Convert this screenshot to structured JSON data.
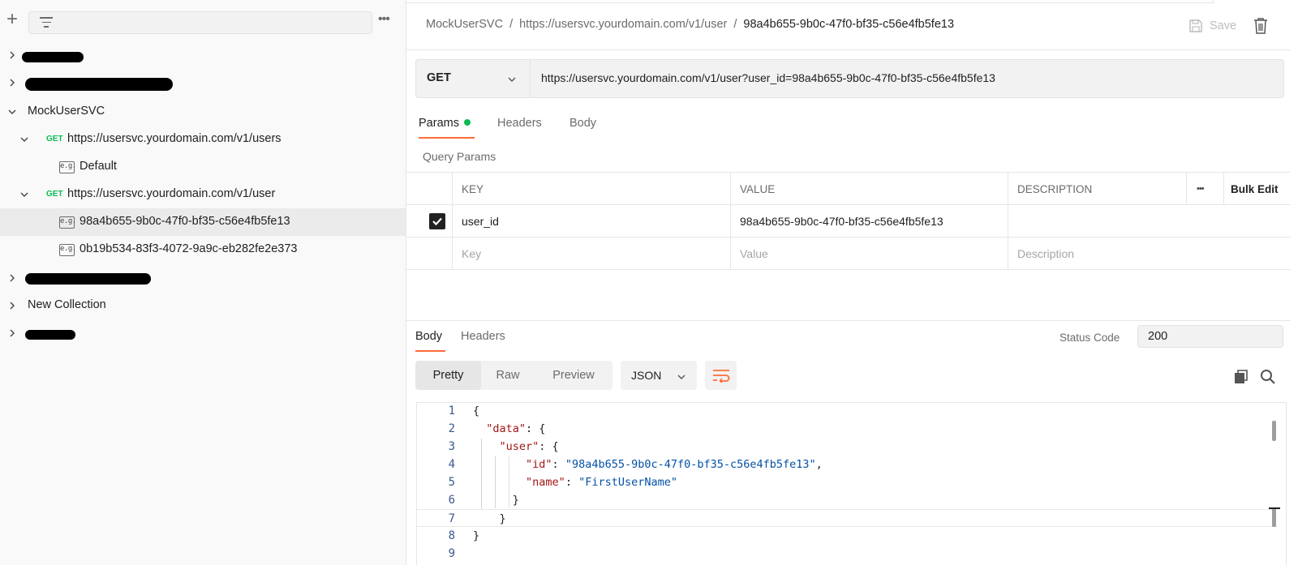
{
  "sidebar": {
    "collections": [
      {
        "label": "",
        "redacted": true,
        "expanded": false
      },
      {
        "label": "",
        "redacted": true,
        "expanded": false
      },
      {
        "label": "MockUserSVC",
        "expanded": true
      },
      {
        "label": "",
        "redacted": true,
        "expanded": false
      },
      {
        "label": "New Collection",
        "expanded": false
      },
      {
        "label": "",
        "redacted": true,
        "expanded": false
      }
    ],
    "requests": [
      {
        "method": "GET",
        "url": "https://usersvc.yourdomain.com/v1/users",
        "examples": [
          {
            "badge": "e.g.",
            "label": "Default"
          }
        ]
      },
      {
        "method": "GET",
        "url": "https://usersvc.yourdomain.com/v1/user",
        "examples": [
          {
            "badge": "e.g.",
            "label": "98a4b655-9b0c-47f0-bf35-c56e4fb5fe13",
            "selected": true
          },
          {
            "badge": "e.g.",
            "label": "0b19b534-83f3-4072-9a9c-eb282fe2e373"
          }
        ]
      }
    ]
  },
  "breadcrumb": {
    "collection": "MockUserSVC",
    "request": "https://usersvc.yourdomain.com/v1/user",
    "current": "98a4b655-9b0c-47f0-bf35-c56e4fb5fe13",
    "separator": "/"
  },
  "toolbar": {
    "save_label": "Save"
  },
  "request": {
    "method": "GET",
    "url": "https://usersvc.yourdomain.com/v1/user?user_id=98a4b655-9b0c-47f0-bf35-c56e4fb5fe13",
    "tabs": [
      {
        "label": "Params",
        "active": true,
        "indicator": "green-dot"
      },
      {
        "label": "Headers"
      },
      {
        "label": "Body"
      }
    ],
    "section_title": "Query Params",
    "params_table": {
      "columns": [
        "KEY",
        "VALUE",
        "DESCRIPTION"
      ],
      "more_label": "•••",
      "bulk_edit_label": "Bulk Edit",
      "rows": [
        {
          "checked": true,
          "key": "user_id",
          "value": "98a4b655-9b0c-47f0-bf35-c56e4fb5fe13",
          "description": ""
        }
      ],
      "placeholders": {
        "key": "Key",
        "value": "Value",
        "description": "Description"
      }
    }
  },
  "response": {
    "tabs": [
      {
        "label": "Body",
        "active": true
      },
      {
        "label": "Headers"
      }
    ],
    "status_code_label": "Status Code",
    "status_code_value": "200",
    "format_tabs": [
      {
        "label": "Pretty",
        "active": true
      },
      {
        "label": "Raw"
      },
      {
        "label": "Preview"
      }
    ],
    "language": "JSON",
    "code_lines": [
      {
        "n": "1",
        "tokens": [
          [
            "p",
            "{"
          ]
        ]
      },
      {
        "n": "2",
        "tokens": [
          [
            "p",
            "  "
          ],
          [
            "k",
            "\"data\""
          ],
          [
            "p",
            ": {"
          ]
        ]
      },
      {
        "n": "3",
        "tokens": [
          [
            "p",
            "    "
          ],
          [
            "k",
            "\"user\""
          ],
          [
            "p",
            ": {"
          ]
        ]
      },
      {
        "n": "4",
        "tokens": [
          [
            "p",
            "        "
          ],
          [
            "k",
            "\"id\""
          ],
          [
            "p",
            ": "
          ],
          [
            "s",
            "\"98a4b655-9b0c-47f0-bf35-c56e4fb5fe13\""
          ],
          [
            "p",
            ","
          ]
        ]
      },
      {
        "n": "5",
        "tokens": [
          [
            "p",
            "        "
          ],
          [
            "k",
            "\"name\""
          ],
          [
            "p",
            ": "
          ],
          [
            "s",
            "\"FirstUserName\""
          ]
        ]
      },
      {
        "n": "6",
        "tokens": [
          [
            "p",
            "      }"
          ]
        ]
      },
      {
        "n": "7",
        "tokens": [
          [
            "p",
            "    }"
          ]
        ]
      },
      {
        "n": "8",
        "tokens": [
          [
            "p",
            "}"
          ]
        ]
      },
      {
        "n": "9",
        "tokens": []
      }
    ]
  },
  "colors": {
    "accent": "#ff6c37",
    "get_method": "#0cbb52",
    "json_key": "#a31515",
    "json_string": "#0451a5"
  }
}
